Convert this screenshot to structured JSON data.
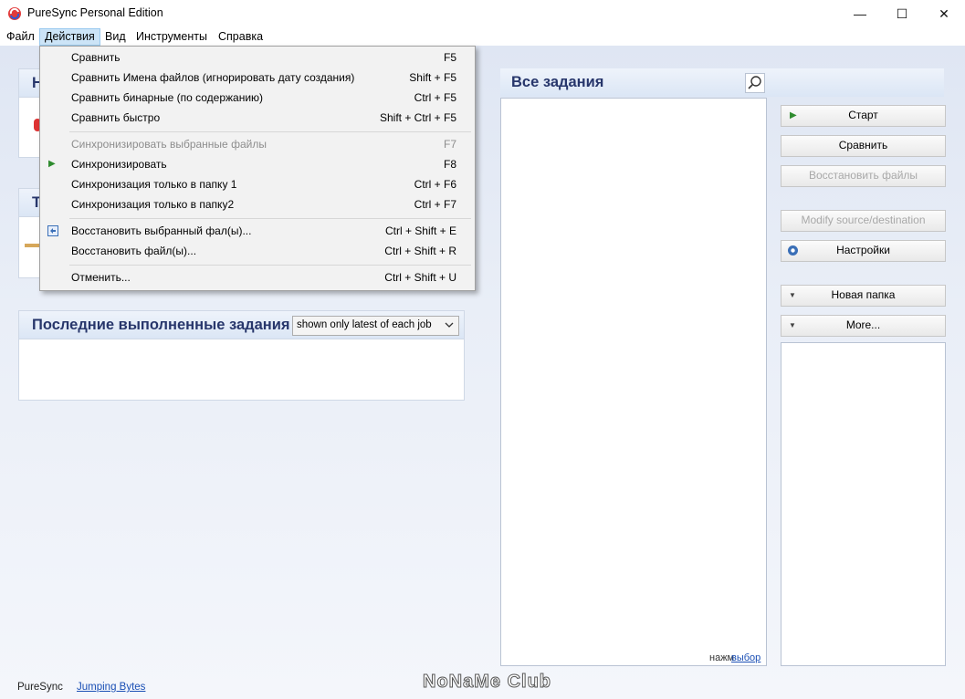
{
  "window": {
    "title": "PureSync Personal Edition",
    "minimize_glyph": "—",
    "maximize_glyph": "☐",
    "close_glyph": "✕"
  },
  "menubar": {
    "items": [
      "Файл",
      "Действия",
      "Вид",
      "Инструменты",
      "Справка"
    ]
  },
  "dropdown": {
    "items": [
      {
        "label": "Сравнить",
        "shortcut": "F5"
      },
      {
        "label": "Сравнить Имена файлов (игнорировать дату создания)",
        "shortcut": "Shift + F5"
      },
      {
        "label": "Сравнить бинарные (по содержанию)",
        "shortcut": "Ctrl + F5"
      },
      {
        "label": "Сравнить быстро",
        "shortcut": "Shift + Ctrl + F5"
      },
      {
        "label": "Синхронизировать выбранные файлы",
        "shortcut": "F7"
      },
      {
        "label": "Синхронизировать",
        "shortcut": "F8"
      },
      {
        "label": "Синхронизация только в папку 1",
        "shortcut": "Ctrl + F6"
      },
      {
        "label": "Синхронизация только в папку2",
        "shortcut": "Ctrl + F7"
      },
      {
        "label": "Восстановить выбранный фал(ы)...",
        "shortcut": "Ctrl + Shift + E"
      },
      {
        "label": "Восстановить файл(ы)...",
        "shortcut": "Ctrl + Shift + R"
      },
      {
        "label": "Отменить...",
        "shortcut": "Ctrl + Shift + U"
      }
    ]
  },
  "left": {
    "panel1_initial": "Н",
    "panel2_initial": "Т",
    "recent_title": "Последние выполненные задания",
    "recent_filter": "shown only latest of each job"
  },
  "jobs": {
    "title": "Все задания",
    "footer_prefix": "нажм",
    "footer_link": "выбор"
  },
  "buttons": {
    "start": "Старт",
    "compare": "Сравнить",
    "restore": "Восстановить файлы",
    "modify": "Modify source/destination",
    "settings": "Настройки",
    "new_folder": "Новая папка",
    "more": "More..."
  },
  "status": {
    "app": "PureSync",
    "vendor": "Jumping Bytes",
    "watermark": "NoNaMe Club"
  },
  "colors": {
    "accent_green": "#2e8b2e",
    "title_blue": "#27366b",
    "link_blue": "#1a4fb5"
  }
}
